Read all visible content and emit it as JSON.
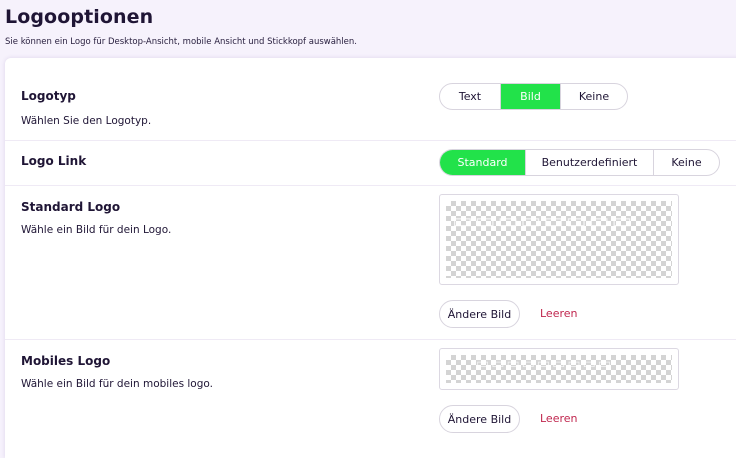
{
  "header": {
    "title": "Logooptionen",
    "subtitle": "Sie können ein Logo für Desktop-Ansicht, mobile Ansicht und Stickkopf auswählen."
  },
  "rows": {
    "logotyp": {
      "title": "Logotyp",
      "description": "Wählen Sie den Logotyp.",
      "options": [
        "Text",
        "Bild",
        "Keine"
      ],
      "selected": "Bild"
    },
    "logo_link": {
      "title": "Logo Link",
      "options": [
        "Standard",
        "Benutzerdefiniert",
        "Keine"
      ],
      "selected": "Standard"
    },
    "standard_logo": {
      "title": "Standard Logo",
      "description": "Wähle ein Bild für dein Logo.",
      "change_label": "Ändere Bild",
      "clear_label": "Leeren"
    },
    "mobile_logo": {
      "title": "Mobiles Logo",
      "description": "Wähle ein Bild für dein mobiles logo.",
      "change_label": "Ändere Bild",
      "clear_label": "Leeren"
    }
  },
  "colors": {
    "accent": "#22e24a",
    "danger": "#c0264e",
    "background": "#f6f2fc",
    "text": "#1f1535"
  }
}
